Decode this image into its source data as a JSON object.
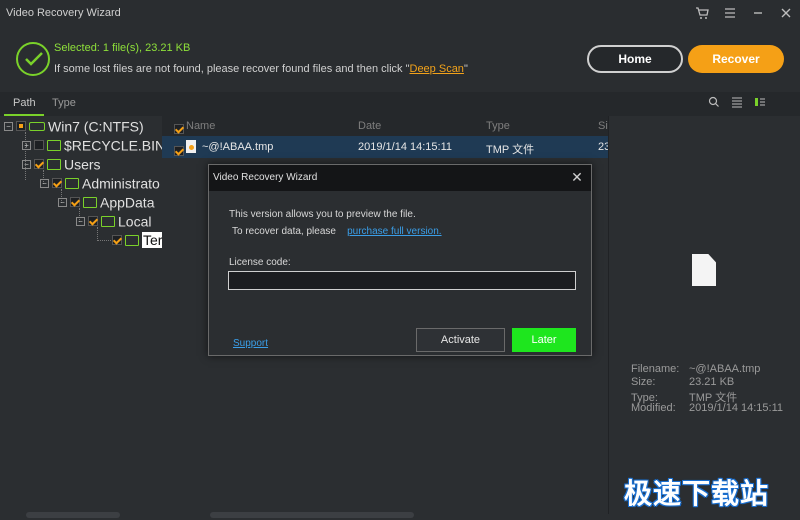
{
  "window": {
    "title": "Video Recovery Wizard"
  },
  "header": {
    "selected": "Selected: 1 file(s), 23.21 KB",
    "hint_prefix": "If some lost files are not found, please recover found files and then click \"",
    "hint_link": "Deep Scan",
    "hint_suffix": "\"",
    "home_label": "Home",
    "recover_label": "Recover"
  },
  "tabs": [
    {
      "label": "Path"
    },
    {
      "label": "Type"
    }
  ],
  "tree": {
    "items": [
      {
        "label": "Win7 (C:NTFS)"
      },
      {
        "label": "$RECYCLE.BIN"
      },
      {
        "label": "Users"
      },
      {
        "label": "Administrato"
      },
      {
        "label": "AppData"
      },
      {
        "label": "Local"
      },
      {
        "label": "Ter"
      }
    ]
  },
  "list": {
    "columns": [
      "Name",
      "Date",
      "Type",
      "Si"
    ],
    "rows": [
      {
        "name": "~@!ABAA.tmp",
        "date": "2019/1/14 14:15:11",
        "type": "TMP 文件",
        "size": "23"
      }
    ]
  },
  "preview": {
    "fields": [
      {
        "key": "Filename:",
        "value": "~@!ABAA.tmp"
      },
      {
        "key": "Size:",
        "value": "23.21 KB"
      },
      {
        "key": "Type:",
        "value": "TMP 文件"
      },
      {
        "key": "Modified:",
        "value": "2019/1/14 14:15:11"
      }
    ]
  },
  "dialog": {
    "title": "Video Recovery Wizard",
    "line1": "This version allows you to preview the file.",
    "line2": "To recover data, please",
    "purchase_link": "purchase full version.",
    "license_label": "License code:",
    "license_value": "",
    "support_link": "Support",
    "activate_label": "Activate",
    "later_label": "Later"
  },
  "watermark": "极速下载站",
  "colors": {
    "accent_green": "#7ad12a",
    "accent_orange": "#f5a016",
    "later_green": "#1ee61e",
    "link_blue": "#3a9ee8"
  }
}
